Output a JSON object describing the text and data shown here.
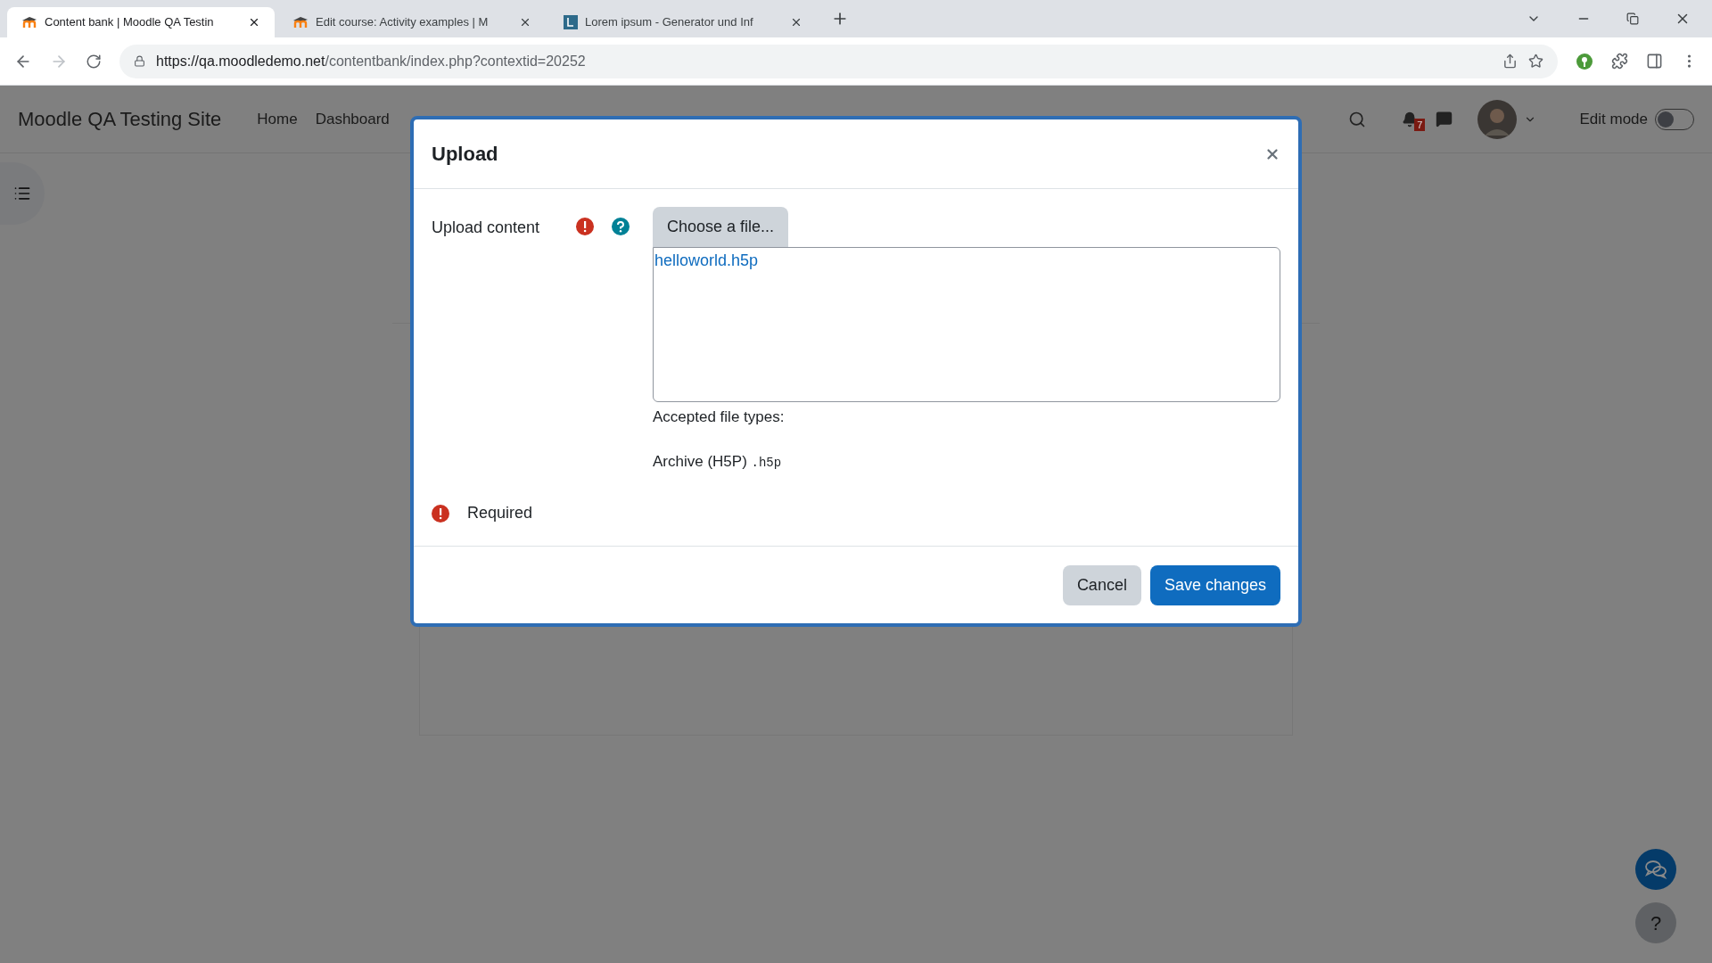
{
  "browser": {
    "tabs": [
      {
        "title": "Content bank | Moodle QA Testin",
        "selected": true,
        "kind": "moodle"
      },
      {
        "title": "Edit course: Activity examples | M",
        "selected": false,
        "kind": "moodle"
      },
      {
        "title": "Lorem ipsum - Generator und Inf",
        "selected": false,
        "kind": "lorem"
      }
    ],
    "url_host": "https://qa.moodledemo.net",
    "url_path": "/contentbank/index.php?contextid=20252"
  },
  "navbar": {
    "site_name": "Moodle QA Testing Site",
    "links": [
      "Home",
      "Dashboard"
    ],
    "notification_count": "7",
    "edit_mode": {
      "label": "Edit mode",
      "on": false
    }
  },
  "modal": {
    "title": "Upload",
    "field_label": "Upload content",
    "choose_button": "Choose a file...",
    "files": [
      "helloworld.h5p"
    ],
    "accepted_label": "Accepted file types:",
    "accepted_type": "Archive (H5P)",
    "accepted_ext": ".h5p",
    "required_label": "Required",
    "buttons": [
      {
        "label": "Cancel",
        "kind": "secondary"
      },
      {
        "label": "Save changes",
        "kind": "primary"
      }
    ]
  },
  "help_button": "?"
}
